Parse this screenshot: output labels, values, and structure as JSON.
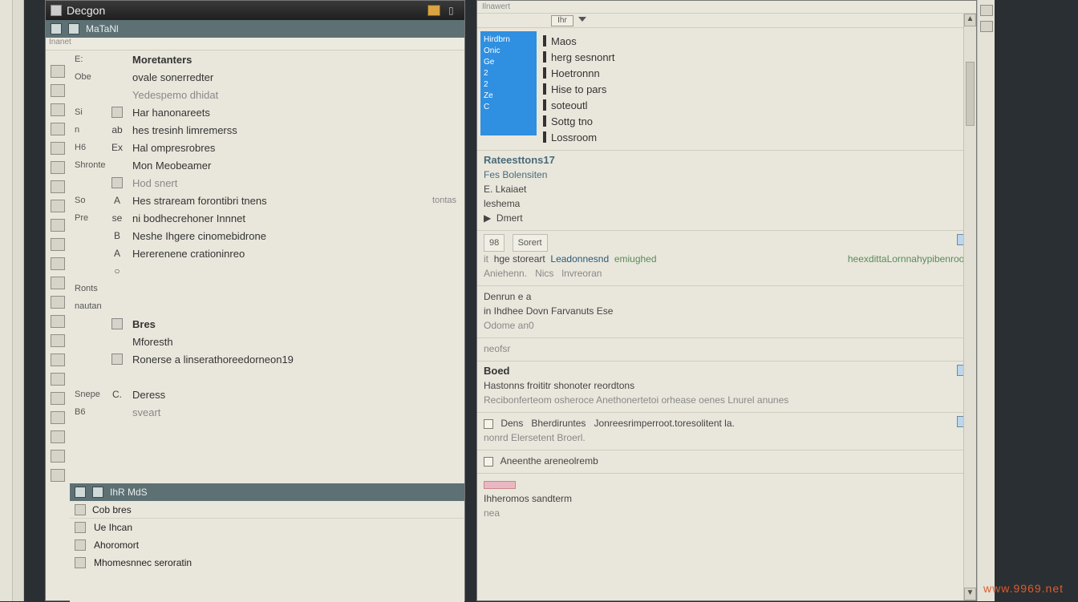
{
  "watermark": "www.9969.net",
  "left_panel": {
    "title": "Decgon",
    "menubar_label": "MaTaNl",
    "small_tab": "Inanet",
    "rows": [
      {
        "a": "E:",
        "b": "",
        "c": "Moretanters",
        "hdr": true
      },
      {
        "a": "Obe",
        "b": "",
        "c": "ovale sonerredter"
      },
      {
        "a": "",
        "b": "",
        "c": "Yedespemo dhidat",
        "muted": true
      },
      {
        "a": "Si",
        "b": "□",
        "c": "Har hanonareets"
      },
      {
        "a": "n",
        "b": "ab",
        "c": "hes tresinh limremerss"
      },
      {
        "a": "H6",
        "b": "Ex",
        "c": "Hal ompresrobres"
      },
      {
        "a": "Shronte",
        "b": "",
        "c": "Mon Meobeamer"
      },
      {
        "a": "",
        "b": "□",
        "c": "Hod snert",
        "muted": true
      },
      {
        "a": "So",
        "b": "A",
        "c": "Hes straream forontibri tnens",
        "right": "tontas"
      },
      {
        "a": "Pre",
        "b": "se",
        "c": "ni bodhecrehoner Innnet"
      },
      {
        "a": "",
        "b": "B",
        "c": "Neshe   Ihgere cinomebidrone"
      },
      {
        "a": "",
        "b": "A",
        "c": "Hererenene crationinreo"
      },
      {
        "a": "",
        "b": "○",
        "c": ""
      },
      {
        "a": "Ronts",
        "b": "",
        "c": "",
        "hdr": true
      },
      {
        "a": "nautan",
        "b": "",
        "c": "",
        "muted": true
      },
      {
        "a": "",
        "b": "▣",
        "c": "Bres",
        "hdr": true
      },
      {
        "a": "",
        "b": "",
        "c": "Mforesth"
      },
      {
        "a": "",
        "b": "□",
        "c": "Ronerse a  linserathoreedorneon19"
      },
      {
        "a": "",
        "b": "",
        "c": ""
      },
      {
        "a": "Snepe",
        "b": "C.",
        "c": "Deress"
      },
      {
        "a": "B6",
        "b": "",
        "c": "sveart",
        "muted": true
      }
    ],
    "dock_bar_label": "IhR MdS",
    "dock_sec_label": "Cob bres",
    "dock_rows": [
      "Ue Ihcan",
      "Ahoromort",
      "Mhomesnnec seroratin"
    ]
  },
  "right_panel": {
    "top_tabs": [
      "Ilnawert",
      "",
      "",
      ""
    ],
    "tool_label": "Ihr",
    "card_lines": [
      "Hirdbrn",
      "Onic",
      "Ge",
      "2",
      "2",
      "Ze",
      "C"
    ],
    "cat_list": [
      "Maos",
      "herg sesnonrt",
      "Hoetronnn",
      "Hise to pars",
      "soteoutl",
      "Sottg tno",
      "Lossroom"
    ],
    "grp1": {
      "title": "Rateesttons17",
      "line1": "Fes Bolensiten",
      "line2": "E. Lkaiaet",
      "line3": "leshema",
      "line4": "Dmert",
      "tri": "▶"
    },
    "grp2": {
      "tags": [
        "98",
        "Sorert"
      ],
      "line1_a": "hge storeart",
      "line1_b": "Leadonnesnd",
      "line1_c": "emiughed",
      "line1_d": "heexdittaLornnahypibenroot.",
      "line2_a": "Aniehenn.",
      "line2_b": "Nics",
      "line2_c": "lnvreoran"
    },
    "grp3": {
      "title": "Denrun e  a",
      "line1": "in     Ihdhee Dovn Farvanuts  Ese",
      "line2": "Odome an0"
    },
    "grp4": {
      "label": "neofsr"
    },
    "grp5": {
      "title": "Boed",
      "line1": "Hastonns froititr shonoter reordtons",
      "line2": "Recibonferteom osheroce  Anethonertetoi orhease oenes  Lnurel anunes"
    },
    "grp6": {
      "cb": true,
      "line1_a": "Dens",
      "line1_b": "Bherdiruntes",
      "line1_c": "Jonreesrimperroot.toresolitent la.",
      "line2": "nonrd  Elersetent Broerl."
    },
    "grp7": {
      "line": "Aneenthe areneolremb"
    },
    "grp8": {
      "line1": "Ihheromos sandterm",
      "line2": "nea"
    }
  }
}
